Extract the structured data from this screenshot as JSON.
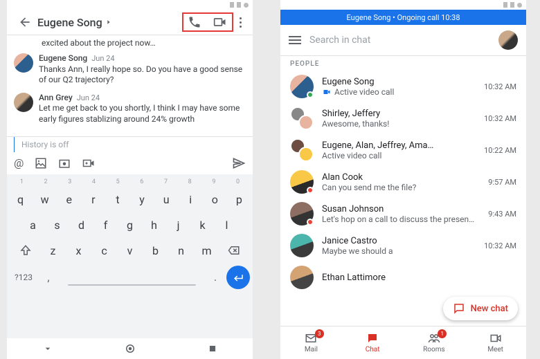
{
  "left": {
    "header": {
      "title": "Eugene Song"
    },
    "snippet": "excited about the project now…",
    "messages": [
      {
        "name": "Eugene Song",
        "date": "Jun 24",
        "text": "Thanks Ann, I really hope so. Do you have a good sense of our Q2 trajectory?"
      },
      {
        "name": "Ann Grey",
        "date": "Jun 24",
        "text": "Let me get back to you shortly, I think I may have some early figures stablizing around 24% growth"
      }
    ],
    "composer": {
      "placeholder": "History is off"
    },
    "keyboard": {
      "nums": [
        "1",
        "2",
        "3",
        "4",
        "5",
        "6",
        "7",
        "8",
        "9",
        "0"
      ],
      "row1": [
        "q",
        "w",
        "e",
        "r",
        "t",
        "y",
        "u",
        "i",
        "o",
        "p"
      ],
      "row2": [
        "a",
        "s",
        "d",
        "f",
        "g",
        "h",
        "j",
        "k",
        "l"
      ],
      "row3": [
        "z",
        "x",
        "c",
        "v",
        "b",
        "n",
        "m"
      ],
      "mode": "?123",
      "comma": ",",
      "dot": "."
    }
  },
  "right": {
    "banner": "Eugene Song • Ongoing call 10:38",
    "search_placeholder": "Search in chat",
    "section_label": "PEOPLE",
    "items": [
      {
        "name": "Eugene Song",
        "sub": "Active video call",
        "time": "10:32 AM",
        "video": true
      },
      {
        "name": "Shirley, Jeffery",
        "sub": "Awesome, thanks!",
        "time": "10:32 AM"
      },
      {
        "name": "Eugene, Alan, Jeffrey, Ama…",
        "sub": "Active video call",
        "time": "10:22 AM"
      },
      {
        "name": "Alan Cook",
        "sub": "Can you send me the file?",
        "time": "9:57 AM"
      },
      {
        "name": "Susan Johnson",
        "sub": "Let's hop on a call to discuss the presen…",
        "time": "9:43 AM"
      },
      {
        "name": "Janice Castro",
        "sub": "Maybe we should a",
        "time": "10:32 AM"
      },
      {
        "name": "Ethan Lattimore",
        "sub": "",
        "time": ""
      }
    ],
    "fab": "New chat",
    "tabs": {
      "mail": {
        "label": "Mail",
        "badge": "3"
      },
      "chat": {
        "label": "Chat"
      },
      "rooms": {
        "label": "Rooms",
        "badge": "1"
      },
      "meet": {
        "label": "Meet"
      }
    }
  }
}
